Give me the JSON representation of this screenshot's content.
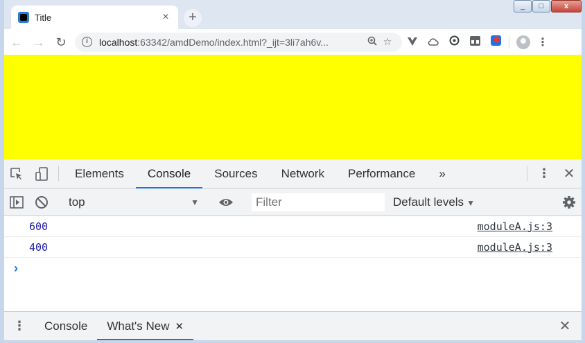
{
  "browser": {
    "tab": {
      "title": "Title",
      "close": "×"
    },
    "new_tab": "+",
    "window_controls": {
      "minimize": "_",
      "maximize": "□",
      "close": "x"
    },
    "nav": {
      "back": "←",
      "forward": "→",
      "reload": "↻"
    },
    "address": {
      "host": "localhost",
      "rest": ":63342/amdDemo/index.html?_ijt=3li7ah6v..."
    }
  },
  "page": {
    "background": "#ffff00"
  },
  "devtools": {
    "tabs": [
      {
        "label": "Elements"
      },
      {
        "label": "Console"
      },
      {
        "label": "Sources"
      },
      {
        "label": "Network"
      },
      {
        "label": "Performance"
      }
    ],
    "more_tabs": "»",
    "active_tab": "Console",
    "console_toolbar": {
      "context": "top",
      "filter_placeholder": "Filter",
      "levels": "Default levels"
    },
    "logs": [
      {
        "value": "600",
        "source": "moduleA.js:3"
      },
      {
        "value": "400",
        "source": "moduleA.js:3"
      }
    ],
    "prompt": "›",
    "drawer": {
      "tabs": [
        {
          "label": "Console"
        },
        {
          "label": "What's New"
        }
      ],
      "active": "What's New"
    }
  }
}
